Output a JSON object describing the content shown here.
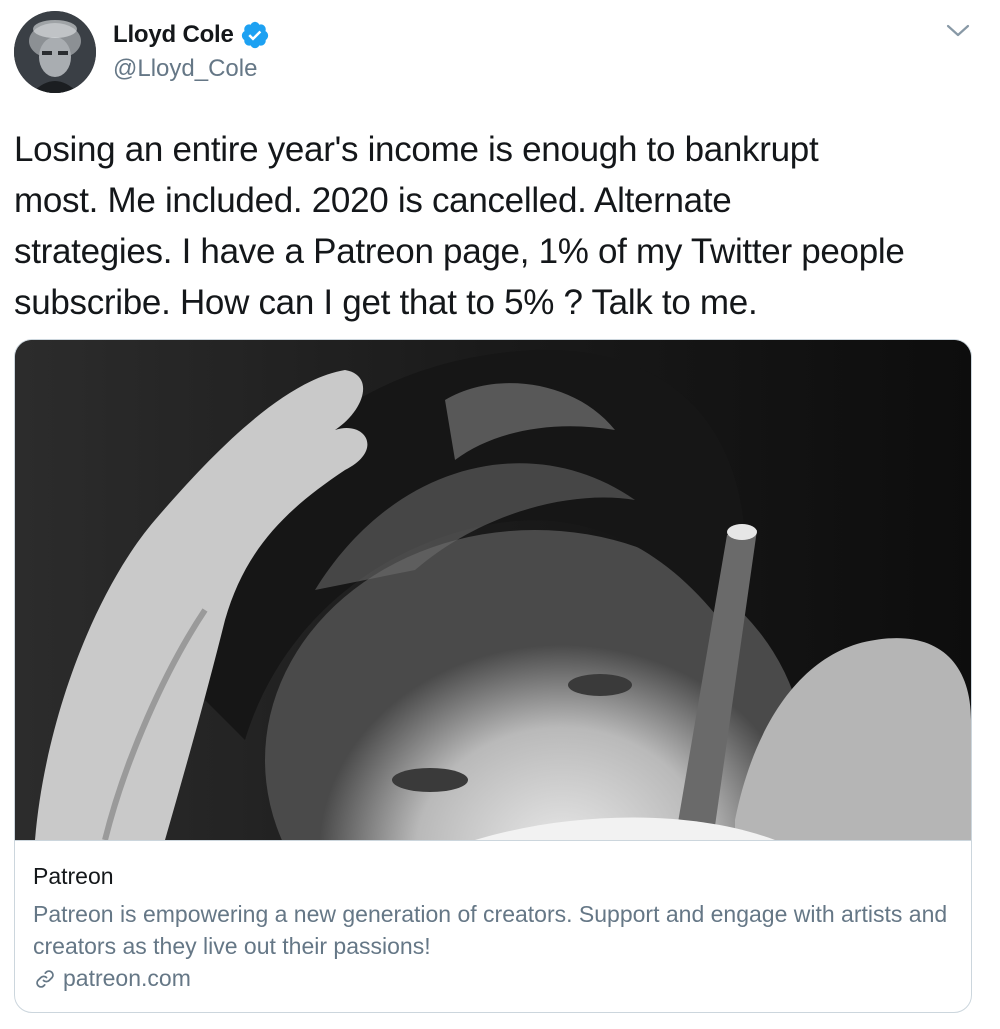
{
  "author": {
    "display_name": "Lloyd Cole",
    "handle": "@Lloyd_Cole",
    "verified": true,
    "avatar_icon": "profile-photo"
  },
  "tweet": {
    "text": "Losing an entire year's income is enough to bankrupt\nmost. Me included. 2020 is cancelled. Alternate\nstrategies. I have a Patreon page, 1% of my Twitter people\nsubscribe. How can I get that to 5% ? Talk to me."
  },
  "card": {
    "site_name": "Patreon",
    "description": "Patreon is empowering a new generation of creators. Support and engage with artists and creators as they live out their passions!",
    "domain": "patreon.com",
    "link_icon": "link-icon"
  },
  "colors": {
    "verified_blue": "#1da1f2",
    "secondary_text": "#657786",
    "border": "#ccd6dd"
  }
}
